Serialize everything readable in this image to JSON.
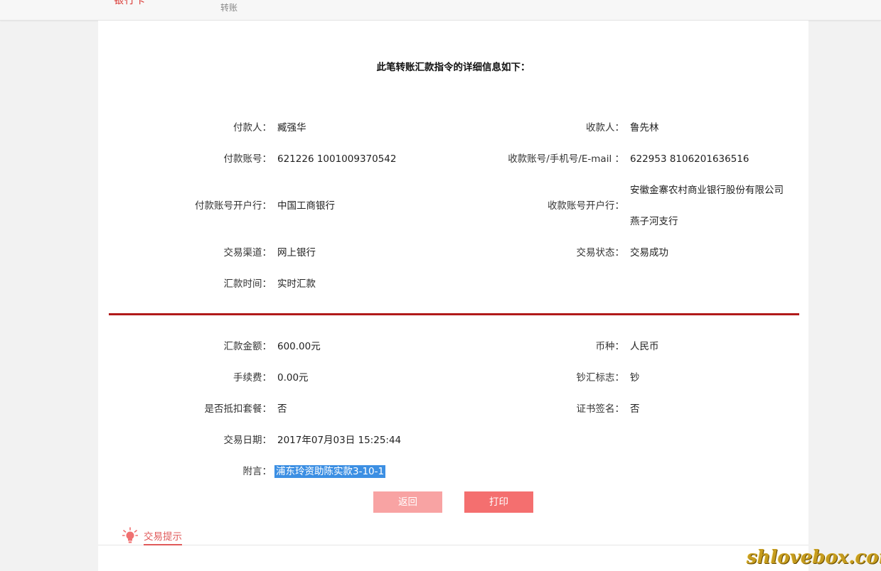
{
  "topbar": {
    "crumb_active": "银行卡",
    "crumb_sub": "转账"
  },
  "title": "此笔转账汇款指令的详细信息如下：",
  "details_top": {
    "payer_label": "付款人：",
    "payer_value": "臧强华",
    "payee_label": "收款人：",
    "payee_value": "鲁先林",
    "payer_account_label": "付款账号：",
    "payer_account_value": "621226 1001009370542",
    "payee_account_label": "收款账号/手机号/E-mail ：",
    "payee_account_value": "622953 8106201636516",
    "payer_bank_label": "付款账号开户行：",
    "payer_bank_value": "中国工商银行",
    "payee_bank_label": "收款账号开户行：",
    "payee_bank_line1": "安徽金寨农村商业银行股份有限公司",
    "payee_bank_line2": "燕子河支行",
    "channel_label": "交易渠道：",
    "channel_value": "网上银行",
    "status_label": "交易状态：",
    "status_value": "交易成功",
    "time_label": "汇款时间：",
    "time_value": "实时汇款"
  },
  "details_bottom": {
    "amount_label": "汇款金额：",
    "amount_value": "600.00元",
    "currency_label": "币种：",
    "currency_value": "人民币",
    "fee_label": "手续费：",
    "fee_value": "0.00元",
    "cash_flag_label": "钞汇标志：",
    "cash_flag_value": "钞",
    "package_label": "是否抵扣套餐：",
    "package_value": "否",
    "cert_label": "证书签名：",
    "cert_value": "否",
    "date_label": "交易日期：",
    "date_value": "2017年07月03日 15:25:44",
    "memo_label": "附言：",
    "memo_value": "浦东玲资助陈实款3-10-1"
  },
  "buttons": {
    "back": "返回",
    "print": "打印"
  },
  "tips": {
    "label": "交易提示",
    "icon": "lightbulb-icon"
  },
  "watermark": "shlovebox.com",
  "colors": {
    "accent": "#b11a1a",
    "button_back": "#f8a3a3",
    "button_print": "#f46f6f",
    "tip_red": "#e05a5a",
    "selection": "#3c8fe3"
  }
}
